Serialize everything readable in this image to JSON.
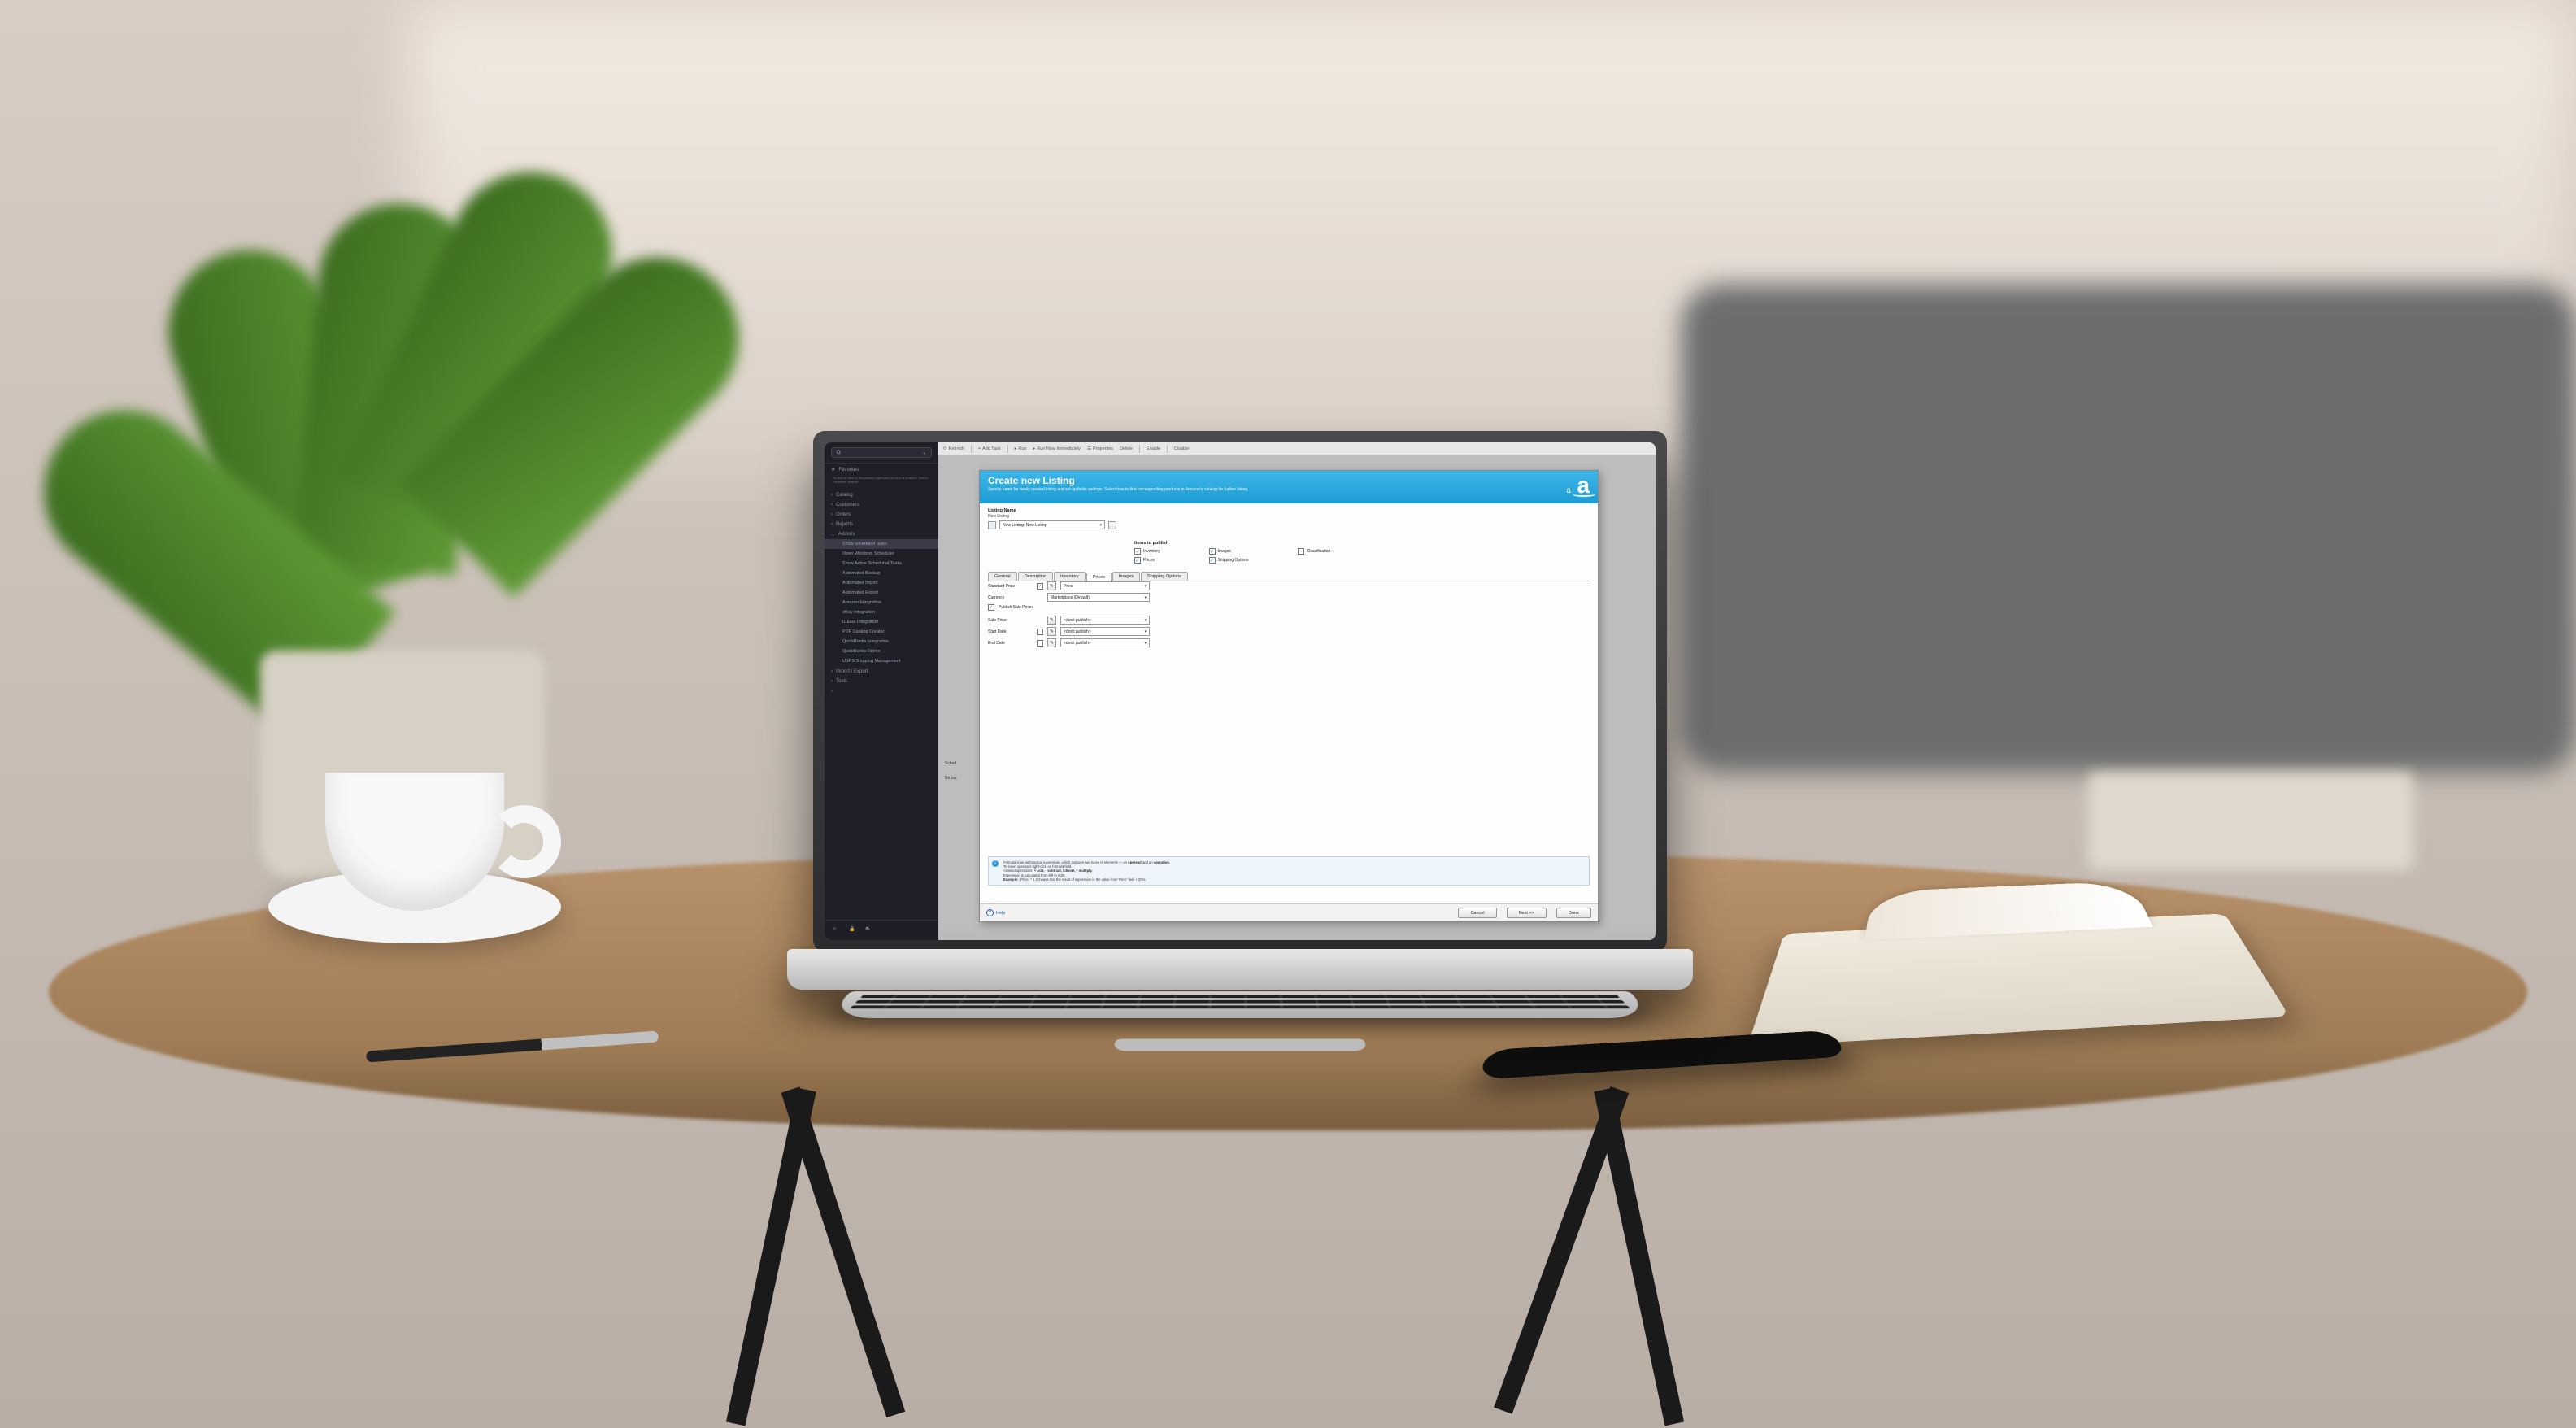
{
  "sidebar": {
    "selector": {
      "value": "O"
    },
    "favorites": {
      "label": "Favorites",
      "note": "To add an item to the primary right-click on item and select \"Add to Favorites\" feature"
    },
    "sections": [
      {
        "label": "Catalog"
      },
      {
        "label": "Customers"
      },
      {
        "label": "Orders"
      },
      {
        "label": "Reports"
      },
      {
        "label": "Addons",
        "expanded": true,
        "children": [
          {
            "label": "Show scheduled tasks",
            "active": true
          },
          {
            "label": "Open Windows Scheduler"
          },
          {
            "label": "Show Active Scheduled Tasks"
          },
          {
            "label": "Automated Backup"
          },
          {
            "label": "Automated Import"
          },
          {
            "label": "Automated Export"
          },
          {
            "label": "Amazon Integration"
          },
          {
            "label": "eBay Integration"
          },
          {
            "label": "ICEcat Integration"
          },
          {
            "label": "PDF Catalog Creator"
          },
          {
            "label": "QuickBooks Integration"
          },
          {
            "label": "QuickBooks Online"
          },
          {
            "label": "USPS Shipping Management"
          }
        ]
      },
      {
        "label": "Import / Export"
      },
      {
        "label": "Tools"
      },
      {
        "label": ""
      }
    ]
  },
  "toolbar": {
    "refresh": "Refresh",
    "add_task": "Add Task",
    "run": "Run",
    "run_now": "Run Now Immediately",
    "properties": "Properties",
    "delete": "Delete",
    "enable": "Enable",
    "disable": "Disable"
  },
  "background_labels": {
    "sched": "Sched",
    "note": "No tas"
  },
  "wizard": {
    "title": "Create new Listing",
    "subtitle": "Specify name for newly created listing and set up fields settings.\nSelect how to find corresponding products in Amazon's catalog for further listing.",
    "listing_name_label": "Listing Name",
    "new_listing_label": "New Listing",
    "listing_value": "New Listing: New Listing",
    "items_to_publish": {
      "heading": "Items to publish",
      "col1": [
        {
          "label": "Inventory",
          "checked": true
        },
        {
          "label": "Prices",
          "checked": true
        }
      ],
      "col2": [
        {
          "label": "Images",
          "checked": true
        },
        {
          "label": "Shipping Options",
          "checked": true
        }
      ],
      "col3": [
        {
          "label": "Classification",
          "checked": false
        }
      ]
    },
    "tabs": [
      "General",
      "Description",
      "Inventory",
      "Prices",
      "Images",
      "Shipping Options"
    ],
    "active_tab": "Prices",
    "price_fields": {
      "standard": {
        "label": "Standard Price",
        "checked": true,
        "value": "Price"
      },
      "currency": {
        "label": "Currency",
        "value": "Marketplace (Default)"
      },
      "publish_sale": {
        "label": "Publish Sale Prices",
        "checked": true
      },
      "sale": {
        "label": "Sale Price",
        "value": "<don't publish>"
      },
      "start": {
        "label": "Start Date",
        "checked": false,
        "value": "<don't publish>"
      },
      "end": {
        "label": "End Date",
        "checked": false,
        "value": "<don't publish>"
      }
    },
    "hint": {
      "line1_a": "Formula is an arithmetical expression, which contains two types of elements — an ",
      "line1_b": "operand",
      "line1_c": " and an ",
      "line1_d": "operation",
      "line1_e": ".",
      "line2": "To insert operands right-click on formula field.",
      "line3_a": "Allowed operations: ",
      "line3_b": "+ Add,  - subtract,  /  divide,  * multiply.",
      "line4_a": "Expression is calculated from left to right.",
      "line5_a": "Example: ",
      "line5_b": "{Price} * 1.2 means that the result of expression is the value from 'Price' field + 20%"
    },
    "buttons": {
      "help": "Help",
      "cancel": "Cancel",
      "next": "Next >>",
      "done": "Done"
    }
  }
}
